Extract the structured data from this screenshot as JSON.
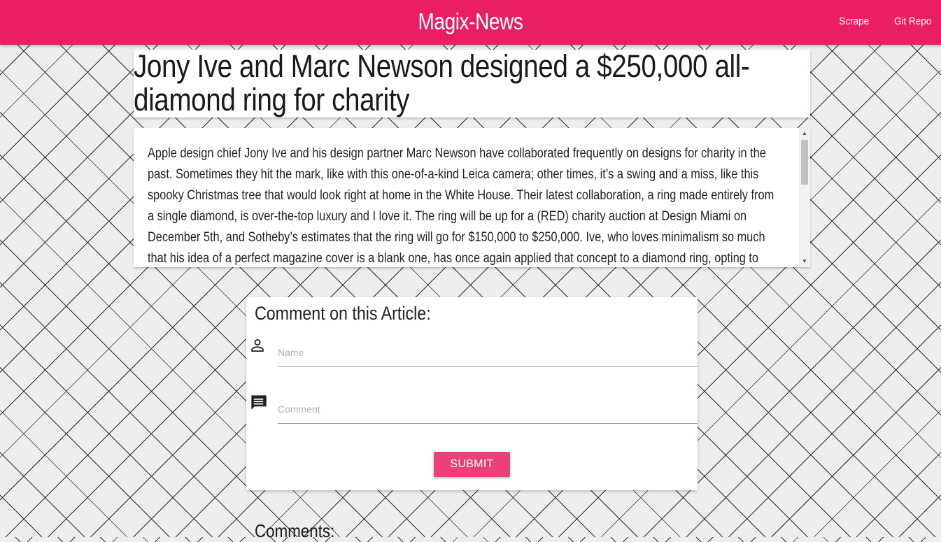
{
  "navbar": {
    "brand": "Magix-News",
    "links": [
      "Scrape",
      "Git Repo"
    ]
  },
  "article": {
    "title": "Jony Ive and Marc Newson designed a $250,000 all-diamond ring for charity",
    "body": "Apple design chief Jony Ive and his design partner Marc Newson have collaborated frequently on designs for charity in the past. Sometimes they hit the mark, like with this one-of-a-kind Leica camera; other times, it’s a swing and a miss, like this spooky Christmas tree that would look right at home in the White House. Their latest collaboration, a ring made entirely from a single diamond, is over-the-top luxury and I love it. The ring will be up for a (RED) charity auction at Design Miami on December 5th, and Sotheby’s estimates that the ring will go for $150,000 to $250,000. Ive, who loves minimalism so much that his idea of a perfect magazine cover is a blank one, has once again applied that concept to a diamond ring, opting to"
  },
  "comment_form": {
    "heading": "Comment on this Article:",
    "name_placeholder": "Name",
    "comment_placeholder": "Comment",
    "submit_label": "Submit",
    "name_icon": "person-icon",
    "comment_icon": "comment-icon"
  },
  "comments": {
    "heading": "Comments:"
  },
  "colors": {
    "primary": "#e91e63",
    "button": "#ec407a",
    "background": "#eeecec"
  }
}
